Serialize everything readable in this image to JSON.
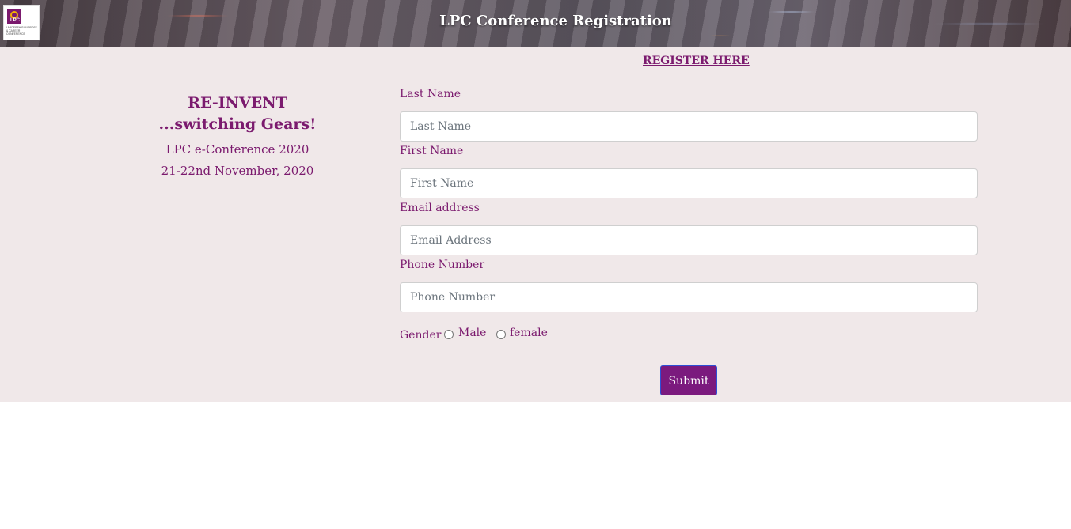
{
  "header": {
    "title": "LPC Conference Registration",
    "logo": {
      "mark": "LPC",
      "text": "Leadership Purpose & Career Conference"
    }
  },
  "register_link": "REGISTER HERE",
  "side": {
    "heading_line1": "RE-INVENT",
    "heading_line2": "...switching Gears!",
    "event": "LPC e-Conference 2020",
    "dates": "21-22nd November, 2020"
  },
  "form": {
    "last_name": {
      "label": "Last Name",
      "placeholder": "Last Name",
      "value": ""
    },
    "first_name": {
      "label": "First Name",
      "placeholder": "First Name",
      "value": ""
    },
    "email": {
      "label": "Email address",
      "placeholder": "Email Address",
      "value": ""
    },
    "phone": {
      "label": "Phone Number",
      "placeholder": "Phone Number",
      "value": ""
    },
    "gender": {
      "label": "Gender",
      "options": [
        "Male",
        "female"
      ],
      "selected": ""
    },
    "submit_label": "Submit"
  },
  "colors": {
    "accent": "#7b1a6e",
    "page_background": "#f0e8e9",
    "button_background": "#7b1a7e",
    "button_border": "#2e4fd6"
  }
}
